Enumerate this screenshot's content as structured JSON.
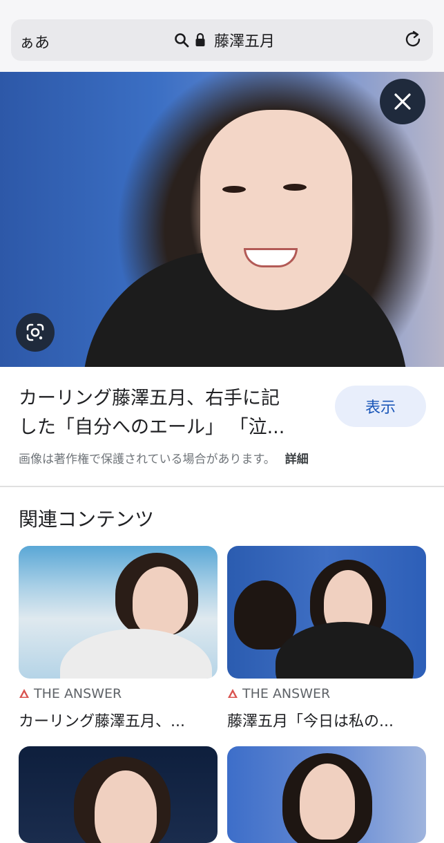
{
  "browser": {
    "text_size_label": "ぁあ",
    "url_text": "藤澤五月"
  },
  "image_viewer": {
    "title_line1": "カーリング藤澤五月、右手に記",
    "title_line2": "した「自分へのエール」 「泣...",
    "show_button": "表示",
    "copyright_note": "画像は著作権で保護されている場合があります。",
    "details_link": "詳細"
  },
  "related": {
    "heading": "関連コンテンツ",
    "items": [
      {
        "source": "THE ANSWER",
        "caption": "カーリング藤澤五月、..."
      },
      {
        "source": "THE ANSWER",
        "caption": "藤澤五月「今日は私の..."
      }
    ]
  },
  "colors": {
    "accent": "#1a56b8",
    "source_icon": "#d9534f"
  },
  "icons": [
    "search-icon",
    "lock-icon",
    "reload-icon",
    "close-icon",
    "google-lens-icon",
    "source-triangle-icon"
  ]
}
